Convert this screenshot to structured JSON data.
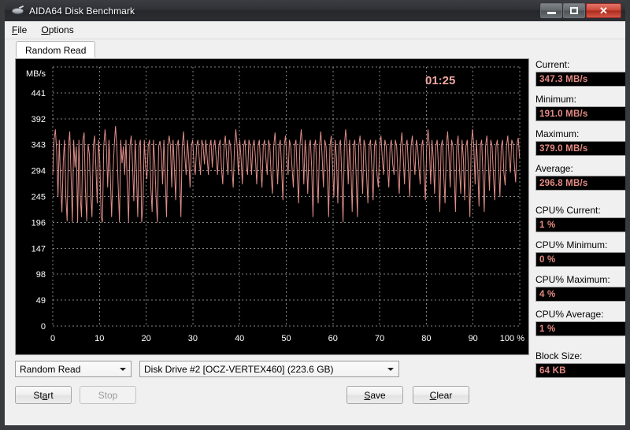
{
  "window": {
    "title": "AIDA64 Disk Benchmark",
    "icon": "disk-icon",
    "minimize_label": "Minimize",
    "maximize_label": "Maximize",
    "close_label": "Close"
  },
  "menubar": {
    "items": [
      {
        "label": "File",
        "accel": "F"
      },
      {
        "label": "Options",
        "accel": "O"
      }
    ]
  },
  "tabs": [
    {
      "label": "Random Read",
      "active": true
    }
  ],
  "stats": [
    {
      "label": "Current:",
      "value": "347.3 MB/s",
      "gap": false
    },
    {
      "label": "Minimum:",
      "value": "191.0 MB/s",
      "gap": false
    },
    {
      "label": "Maximum:",
      "value": "379.0 MB/s",
      "gap": false
    },
    {
      "label": "Average:",
      "value": "296.8 MB/s",
      "gap": false
    },
    {
      "label": "CPU% Current:",
      "value": "1 %",
      "gap": true
    },
    {
      "label": "CPU% Minimum:",
      "value": "0 %",
      "gap": false
    },
    {
      "label": "CPU% Maximum:",
      "value": "4 %",
      "gap": false
    },
    {
      "label": "CPU% Average:",
      "value": "1 %",
      "gap": false
    },
    {
      "label": "Block Size:",
      "value": "64 KB",
      "gap": true
    }
  ],
  "controls": {
    "mode_select": {
      "value": "Random Read"
    },
    "drive_select": {
      "value": "Disk Drive #2  [OCZ-VERTEX460]  (223.6 GB)"
    },
    "start_button": {
      "label": "Start",
      "accel": "a",
      "enabled": false
    },
    "stop_button": {
      "label": "Stop",
      "enabled": true
    },
    "save_button": {
      "label": "Save",
      "accel": "S",
      "enabled": true
    },
    "clear_button": {
      "label": "Clear",
      "accel": "C",
      "enabled": true
    }
  },
  "colors": {
    "plot_background": "#000000",
    "trace": "#e08e88",
    "grid": "#9a9a9a",
    "value_text": "#e58b84",
    "timer": "#f0a9a2"
  },
  "chart_data": {
    "type": "line",
    "title": "",
    "xlabel": "",
    "ylabel": "MB/s",
    "unit_label": "MB/s",
    "timer": "01:25",
    "grid": true,
    "legend": "none",
    "xlim": [
      0,
      100
    ],
    "ylim": [
      0,
      490
    ],
    "x_tick_labels": [
      "0",
      "10",
      "20",
      "30",
      "40",
      "50",
      "60",
      "70",
      "80",
      "90",
      "100 %"
    ],
    "x_ticks": [
      0,
      10,
      20,
      30,
      40,
      50,
      60,
      70,
      80,
      90,
      100
    ],
    "y_tick_labels": [
      "0",
      "49",
      "98",
      "147",
      "196",
      "245",
      "294",
      "343",
      "392",
      "441"
    ],
    "y_ticks": [
      0,
      49,
      98,
      147,
      196,
      245,
      294,
      343,
      392,
      441
    ],
    "series": [
      {
        "name": "Random Read",
        "color": "#e08e88",
        "x": [
          0,
          0.28,
          0.56,
          0.84,
          1.12,
          1.4,
          1.68,
          1.96,
          2.24,
          2.52,
          2.8,
          3.08,
          3.36,
          3.64,
          3.92,
          4.2,
          4.48,
          4.76,
          5.04,
          5.32,
          5.6,
          5.88,
          6.16,
          6.44,
          6.72,
          7,
          7.28,
          7.56,
          7.84,
          8.12,
          8.4,
          8.68,
          8.96,
          9.24,
          9.52,
          9.8,
          10.08,
          10.36,
          10.64,
          10.92,
          11.2,
          11.48,
          11.76,
          12.04,
          12.32,
          12.6,
          12.88,
          13.16,
          13.44,
          13.72,
          14,
          14.28,
          14.56,
          14.84,
          15.12,
          15.4,
          15.68,
          15.96,
          16.24,
          16.52,
          16.8,
          17.08,
          17.36,
          17.64,
          17.92,
          18.2,
          18.48,
          18.76,
          19.04,
          19.32,
          19.6,
          19.88,
          20.16,
          20.44,
          20.72,
          21,
          21.28,
          21.56,
          21.84,
          22.12,
          22.4,
          22.68,
          22.96,
          23.24,
          23.52,
          23.8,
          24.08,
          24.36,
          24.64,
          24.92,
          25.2,
          25.48,
          25.76,
          26.04,
          26.32,
          26.6,
          26.88,
          27.16,
          27.44,
          27.72,
          28,
          28.28,
          28.56,
          28.84,
          29.12,
          29.4,
          29.68,
          29.96,
          30.24,
          30.52,
          30.8,
          31.08,
          31.36,
          31.64,
          31.92,
          32.2,
          32.48,
          32.76,
          33.04,
          33.32,
          33.6,
          33.88,
          34.16,
          34.44,
          34.72,
          35,
          35.28,
          35.56,
          35.84,
          36.12,
          36.4,
          36.68,
          36.96,
          37.24,
          37.52,
          37.8,
          38.08,
          38.36,
          38.64,
          38.92,
          39.2,
          39.48,
          39.76,
          40.04,
          40.32,
          40.6,
          40.88,
          41.16,
          41.44,
          41.72,
          42,
          42.28,
          42.56,
          42.84,
          43.12,
          43.4,
          43.68,
          43.96,
          44.24,
          44.52,
          44.8,
          45.08,
          45.36,
          45.64,
          45.92,
          46.2,
          46.48,
          46.76,
          47.04,
          47.32,
          47.6,
          47.88,
          48.16,
          48.44,
          48.72,
          49,
          49.28,
          49.56,
          49.84,
          50.12,
          50.4,
          50.68,
          50.96,
          51.24,
          51.52,
          51.8,
          52.08,
          52.36,
          52.64,
          52.92,
          53.2,
          53.48,
          53.76,
          54.04,
          54.32,
          54.6,
          54.88,
          55.16,
          55.44,
          55.72,
          56,
          56.28,
          56.56,
          56.84,
          57.12,
          57.4,
          57.68,
          57.96,
          58.24,
          58.52,
          58.8,
          59.08,
          59.36,
          59.64,
          59.92,
          60.2,
          60.48,
          60.76,
          61.04,
          61.32,
          61.6,
          61.88,
          62.16,
          62.44,
          62.72,
          63,
          63.28,
          63.56,
          63.84,
          64.12,
          64.4,
          64.68,
          64.96,
          65.24,
          65.52,
          65.8,
          66.08,
          66.36,
          66.64,
          66.92,
          67.2,
          67.48,
          67.76,
          68.04,
          68.32,
          68.6,
          68.88,
          69.16,
          69.44,
          69.72,
          70,
          70.28,
          70.56,
          70.84,
          71.12,
          71.4,
          71.68,
          71.96,
          72.24,
          72.52,
          72.8,
          73.08,
          73.36,
          73.64,
          73.92,
          74.2,
          74.48,
          74.76,
          75.04,
          75.32,
          75.6,
          75.88,
          76.16,
          76.44,
          76.72,
          77,
          77.28,
          77.56,
          77.84,
          78.12,
          78.4,
          78.68,
          78.96,
          79.24,
          79.52,
          79.8,
          80.08,
          80.36,
          80.64,
          80.92,
          81.2,
          81.48,
          81.76,
          82.04,
          82.32,
          82.6,
          82.88,
          83.16,
          83.44,
          83.72,
          84,
          84.28,
          84.56,
          84.84,
          85.12,
          85.4,
          85.68,
          85.96,
          86.24,
          86.52,
          86.8,
          87.08,
          87.36,
          87.64,
          87.92,
          88.2,
          88.48,
          88.76,
          89.04,
          89.32,
          89.6,
          89.88,
          90.16,
          90.44,
          90.72,
          91,
          91.28,
          91.56,
          91.84,
          92.12,
          92.4,
          92.68,
          92.96,
          93.24,
          93.52,
          93.8,
          94.08,
          94.36,
          94.64,
          94.92,
          95.2,
          95.48,
          95.76,
          96.04,
          96.32,
          96.6,
          96.88,
          97.16,
          97.44,
          97.72,
          98,
          98.28,
          98.56,
          98.84,
          99.12,
          99.4,
          99.68,
          99.96
        ],
        "y": [
          286,
          352,
          372,
          330,
          244,
          352,
          268,
          215,
          310,
          352,
          246,
          198,
          340,
          368,
          284,
          196,
          352,
          300,
          340,
          196,
          352,
          246,
          206,
          352,
          366,
          255,
          198,
          344,
          325,
          250,
          206,
          340,
          360,
          300,
          232,
          352,
          310,
          206,
          196,
          340,
          372,
          340,
          262,
          352,
          286,
          206,
          286,
          340,
          378,
          340,
          268,
          196,
          352,
          308,
          340,
          286,
          352,
          262,
          196,
          340,
          360,
          306,
          236,
          352,
          290,
          206,
          340,
          352,
          196,
          232,
          352,
          300,
          278,
          340,
          352,
          262,
          216,
          352,
          310,
          244,
          196,
          340,
          350,
          328,
          268,
          352,
          286,
          206,
          340,
          360,
          340,
          262,
          352,
          300,
          238,
          340,
          352,
          286,
          206,
          340,
          368,
          322,
          286,
          352,
          318,
          262,
          340,
          352,
          306,
          286,
          340,
          352,
          318,
          286,
          352,
          340,
          306,
          352,
          322,
          286,
          340,
          352,
          300,
          340,
          352,
          318,
          286,
          340,
          352,
          300,
          268,
          340,
          360,
          318,
          286,
          352,
          340,
          300,
          262,
          340,
          372,
          340,
          286,
          352,
          318,
          268,
          340,
          352,
          306,
          286,
          352,
          340,
          286,
          340,
          352,
          318,
          268,
          340,
          352,
          300,
          262,
          340,
          352,
          318,
          286,
          352,
          340,
          286,
          250,
          340,
          366,
          322,
          268,
          340,
          352,
          300,
          238,
          340,
          360,
          318,
          286,
          352,
          340,
          300,
          262,
          340,
          352,
          286,
          232,
          340,
          372,
          340,
          268,
          352,
          318,
          250,
          340,
          352,
          300,
          206,
          340,
          352,
          286,
          232,
          340,
          368,
          322,
          262,
          352,
          340,
          286,
          206,
          340,
          360,
          300,
          244,
          352,
          318,
          232,
          340,
          352,
          286,
          196,
          340,
          372,
          340,
          268,
          352,
          300,
          216,
          340,
          352,
          286,
          206,
          340,
          360,
          318,
          250,
          352,
          340,
          286,
          232,
          340,
          352,
          300,
          238,
          340,
          352,
          286,
          262,
          340,
          360,
          318,
          286,
          352,
          340,
          300,
          262,
          340,
          352,
          306,
          286,
          352,
          340,
          286,
          250,
          340,
          366,
          322,
          268,
          340,
          352,
          300,
          244,
          340,
          360,
          318,
          286,
          352,
          340,
          300,
          268,
          340,
          352,
          286,
          238,
          340,
          372,
          340,
          268,
          352,
          318,
          250,
          340,
          352,
          300,
          216,
          340,
          352,
          286,
          232,
          340,
          368,
          322,
          262,
          352,
          340,
          286,
          216,
          340,
          360,
          300,
          250,
          352,
          318,
          238,
          340,
          352,
          286,
          206,
          340,
          372,
          340,
          268,
          352,
          300,
          226,
          340,
          352,
          286,
          216,
          340,
          360,
          318,
          256,
          352,
          340,
          286,
          238,
          340,
          352,
          300,
          244,
          340,
          352,
          290,
          266,
          340,
          360,
          318,
          290,
          352,
          344,
          306,
          272,
          344,
          356,
          318,
          290,
          352,
          340,
          300,
          272,
          344,
          352,
          318,
          296,
          352,
          340,
          306,
          340
        ]
      }
    ]
  }
}
